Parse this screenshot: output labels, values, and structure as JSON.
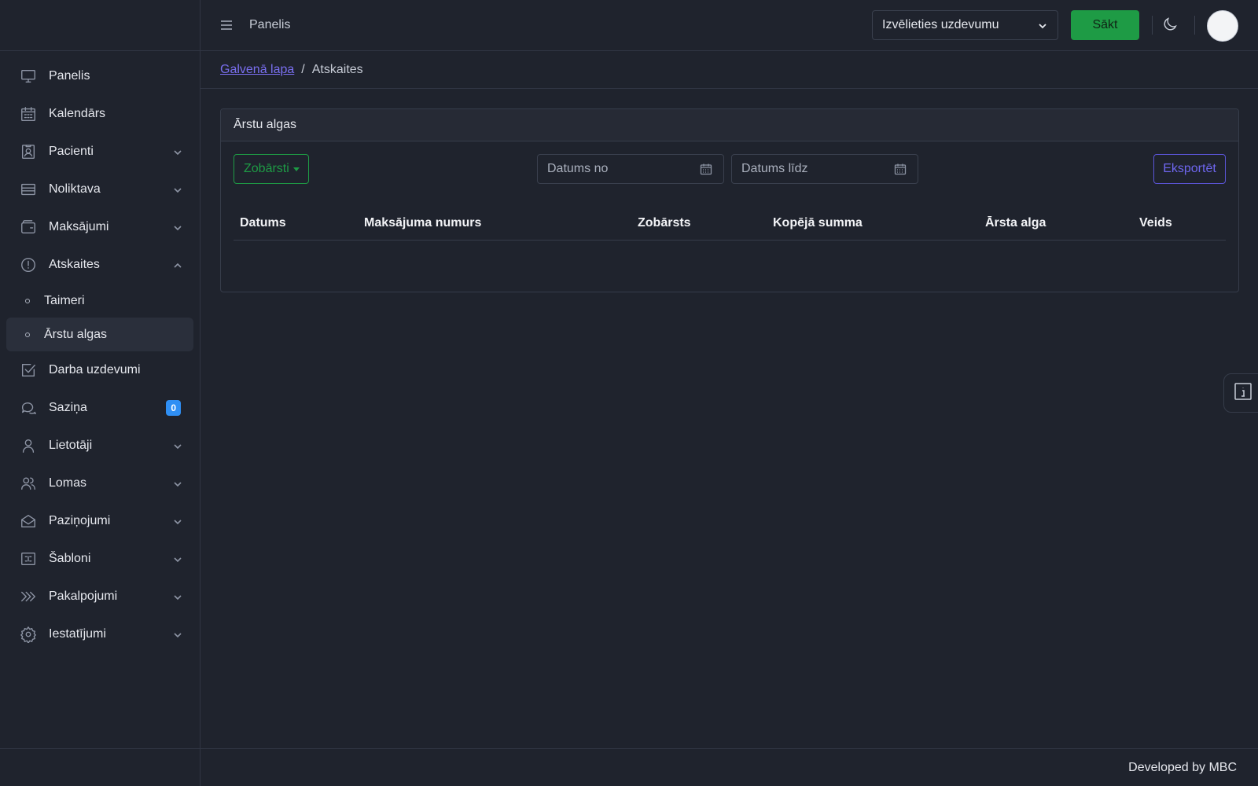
{
  "topbar": {
    "title": "Panelis",
    "task_select_value": "Izvēlieties uzdevumu",
    "start_label": "Sākt"
  },
  "sidebar": {
    "items": [
      {
        "label": "Panelis",
        "icon": "monitor-icon"
      },
      {
        "label": "Kalendārs",
        "icon": "calendar-icon"
      },
      {
        "label": "Pacienti",
        "icon": "patient-card-icon"
      },
      {
        "label": "Noliktava",
        "icon": "storage-icon"
      },
      {
        "label": "Maksājumi",
        "icon": "wallet-icon"
      },
      {
        "label": "Atskaites",
        "icon": "alert-circle-icon"
      },
      {
        "label": "Darba uzdevumi",
        "icon": "checkbox-icon"
      },
      {
        "label": "Saziņa",
        "icon": "chat-icon",
        "badge": "0"
      },
      {
        "label": "Lietotāji",
        "icon": "user-icon"
      },
      {
        "label": "Lomas",
        "icon": "users-icon"
      },
      {
        "label": "Paziņojumi",
        "icon": "envelope-icon"
      },
      {
        "label": "Šabloni",
        "icon": "template-icon"
      },
      {
        "label": "Pakalpojumi",
        "icon": "services-icon"
      },
      {
        "label": "Iestatījumi",
        "icon": "gear-icon"
      }
    ],
    "subitems": [
      {
        "label": "Taimeri"
      },
      {
        "label": "Ārstu algas"
      }
    ]
  },
  "breadcrumb": {
    "home": "Galvenā lapa",
    "separator": "/",
    "current": "Atskaites"
  },
  "card": {
    "title": "Ārstu algas",
    "dentists_label": "Zobārsti",
    "date_from_placeholder": "Datums no",
    "date_to_placeholder": "Datums līdz",
    "export_label": "Eksportēt",
    "columns": [
      "Datums",
      "Maksājuma numurs",
      "Zobārsts",
      "Kopējā summa",
      "Ārsta alga",
      "Veids"
    ]
  },
  "footer": {
    "text": "Developed by MBC"
  },
  "colors": {
    "background": "#1f232d",
    "accent_green": "#1e9b45",
    "accent_purple": "#6f67f0",
    "badge_blue": "#2f8ff4"
  }
}
